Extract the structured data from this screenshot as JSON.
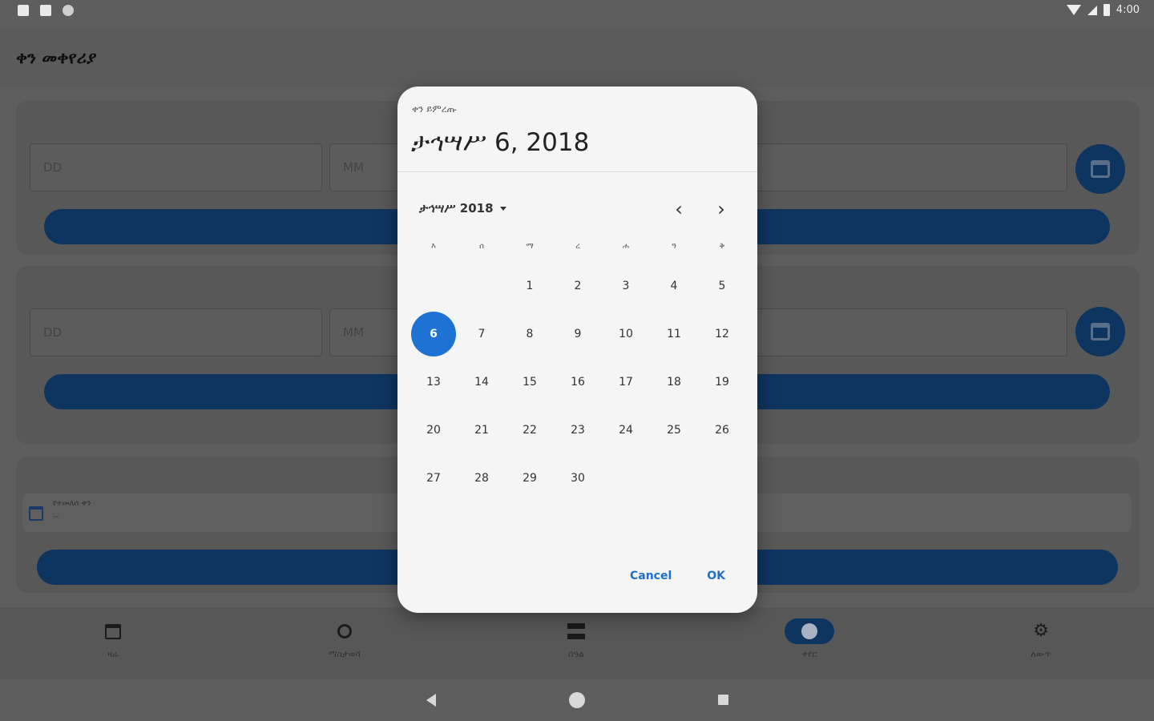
{
  "status_bar": {
    "time": "4:00"
  },
  "app": {
    "title": "ቀን መቀየሪያ"
  },
  "form": {
    "day_placeholder": "DD",
    "month_placeholder": "MM",
    "result_label": "የተመለሰ ቀን",
    "result_value": "--"
  },
  "dialog": {
    "overline": "ቀን ይምረጡ",
    "headline": "ታኅሣሥ 6, 2018",
    "month_year": "ታኅሣሥ 2018",
    "prev_glyph": "‹",
    "next_glyph": "›",
    "weekdays": [
      "እ",
      "ሰ",
      "ማ",
      "ረ",
      "ሐ",
      "ዓ",
      "ቅ"
    ],
    "leading_blanks": 2,
    "days": [
      "1",
      "2",
      "3",
      "4",
      "5",
      "6",
      "7",
      "8",
      "9",
      "10",
      "11",
      "12",
      "13",
      "14",
      "15",
      "16",
      "17",
      "18",
      "19",
      "20",
      "21",
      "22",
      "23",
      "24",
      "25",
      "26",
      "27",
      "28",
      "29",
      "30"
    ],
    "selected_day": "6",
    "cancel_label": "Cancel",
    "ok_label": "OK"
  },
  "bottom_nav": {
    "items": [
      {
        "label": "ዛሬ",
        "icon": "calendar-icon"
      },
      {
        "label": "ማስታወሻ",
        "icon": "ring-icon"
      },
      {
        "label": "በዓል",
        "icon": "list-icon"
      },
      {
        "label": "ቀየር",
        "icon": "compass-icon",
        "active": true
      },
      {
        "label": "ለውጥ",
        "icon": "gear-icon"
      }
    ]
  },
  "colors": {
    "accent": "#1e72d4",
    "primary_dark": "#0e3460",
    "scrim": "#5e5e5e",
    "dialog_surface": "#f5f5f5"
  }
}
